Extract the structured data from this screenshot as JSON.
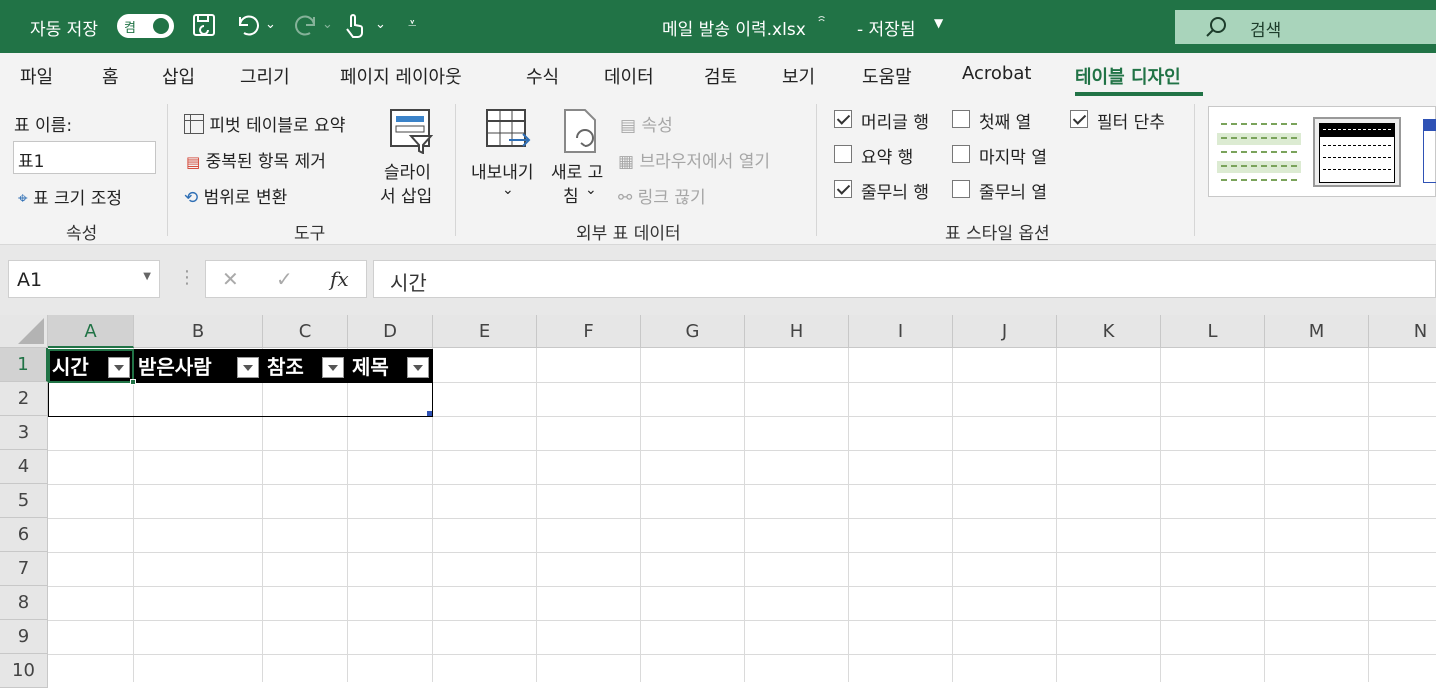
{
  "title_bar": {
    "autosave_label": "자동 저장",
    "autosave_state": "켬",
    "file_name": "메일 발송 이력.xlsx",
    "save_status": "- 저장됨",
    "search_placeholder": "검색"
  },
  "menu": [
    "파일",
    "홈",
    "삽입",
    "그리기",
    "페이지 레이아웃",
    "수식",
    "데이터",
    "검토",
    "보기",
    "도움말",
    "Acrobat",
    "테이블 디자인"
  ],
  "ribbon": {
    "properties": {
      "name_label": "표 이름:",
      "name_value": "표1",
      "resize": "표 크기 조정",
      "group": "속성"
    },
    "tools": {
      "pivot": "피벗 테이블로 요약",
      "remove_dup": "중복된 항목 제거",
      "convert": "범위로 변환",
      "slicer_1": "슬라이",
      "slicer_2": "서 삽입",
      "group": "도구"
    },
    "external": {
      "export_1": "내보내기",
      "refresh_1": "새로 고",
      "refresh_2": "침",
      "properties": "속성",
      "open_browser": "브라우저에서 열기",
      "unlink": "링크 끊기",
      "group": "외부 표 데이터"
    },
    "style_options": {
      "header_row": "머리글 행",
      "first_col": "첫째 열",
      "filter_btn": "필터 단추",
      "total_row": "요약 행",
      "last_col": "마지막 열",
      "banded_rows": "줄무늬 행",
      "banded_cols": "줄무늬 열",
      "group": "표 스타일 옵션"
    }
  },
  "formula_bar": {
    "cell_ref": "A1",
    "value": "시간"
  },
  "columns": [
    "A",
    "B",
    "C",
    "D",
    "E",
    "F",
    "G",
    "H",
    "I",
    "J",
    "K",
    "L",
    "M",
    "N"
  ],
  "rows": [
    "1",
    "2",
    "3",
    "4",
    "5",
    "6",
    "7",
    "8",
    "9",
    "10"
  ],
  "table_headers": [
    "시간",
    "받은사람",
    "참조",
    "제목"
  ],
  "colors": {
    "accent": "#217346"
  }
}
